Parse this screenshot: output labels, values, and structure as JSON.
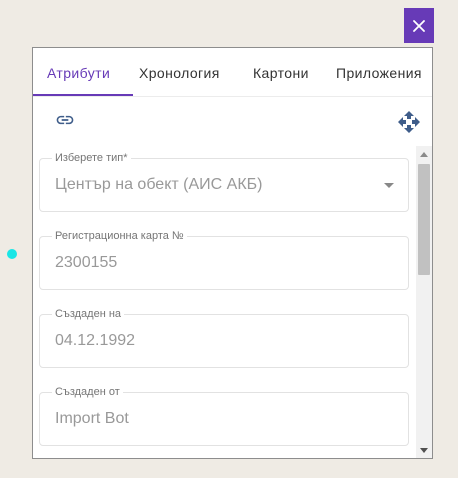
{
  "tabs": [
    {
      "label": "Атрибути",
      "active": true
    },
    {
      "label": "Хронология"
    },
    {
      "label": "Картони"
    },
    {
      "label": "Приложения"
    }
  ],
  "toolbar": {
    "link_icon": "link-icon",
    "move_icon": "move-arrows-icon"
  },
  "form": {
    "type_field": {
      "label": "Изберете тип*",
      "value": "Център на обект (АИС АКБ)"
    },
    "registration_card": {
      "label": "Регистрационна карта №",
      "value": "2300155"
    },
    "created_on": {
      "label": "Създаден на",
      "value": "04.12.1992"
    },
    "created_by": {
      "label": "Създаден от",
      "value": "Import Bot"
    }
  },
  "colors": {
    "accent": "#673ab7",
    "marker": "#19e6e6",
    "background": "#efebe4",
    "icon": "#3f5d8a"
  }
}
